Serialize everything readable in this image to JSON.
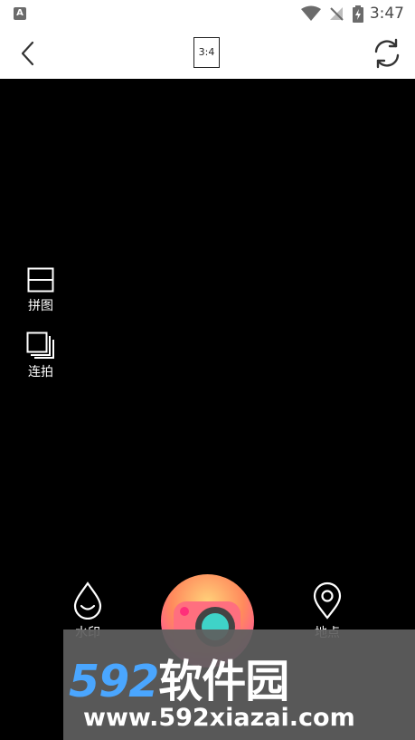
{
  "status_bar": {
    "app_badge": "A",
    "time": "3:47",
    "icons": [
      "wifi-icon",
      "no-signal-icon",
      "battery-charging-icon"
    ]
  },
  "toolbar": {
    "back_icon": "chevron-left-icon",
    "aspect_ratio": "3:4",
    "switch_icon": "camera-switch-icon"
  },
  "side_tools": [
    {
      "icon": "collage-icon",
      "label": "拼图"
    },
    {
      "icon": "burst-icon",
      "label": "连拍"
    }
  ],
  "bottom_tools": {
    "left": {
      "icon": "watermark-drop-icon",
      "label": "水印"
    },
    "right": {
      "icon": "location-pin-icon",
      "label": "地点"
    },
    "shutter_icon": "camera-shutter-icon"
  },
  "watermark": {
    "brand_number": "592",
    "brand_text": "软件园",
    "url": "www.592xiazai.com"
  }
}
